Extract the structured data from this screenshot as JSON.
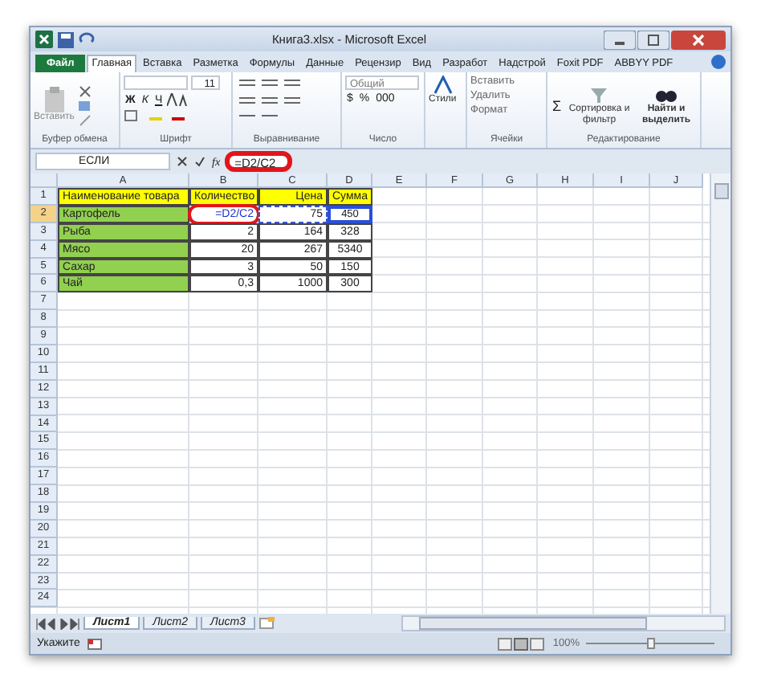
{
  "window": {
    "title": "Книга3.xlsx - Microsoft Excel"
  },
  "ribbon_tabs": [
    {
      "label": "Файл",
      "kind": "file",
      "selected": false
    },
    {
      "label": "Главная",
      "kind": "tab",
      "selected": true
    },
    {
      "label": "Вставка",
      "kind": "tab",
      "selected": false
    },
    {
      "label": "Разметка",
      "kind": "tab",
      "selected": false
    },
    {
      "label": "Формулы",
      "kind": "tab",
      "selected": false
    },
    {
      "label": "Данные",
      "kind": "tab",
      "selected": false
    },
    {
      "label": "Рецензир",
      "kind": "tab",
      "selected": false
    },
    {
      "label": "Вид",
      "kind": "tab",
      "selected": false
    },
    {
      "label": "Разработ",
      "kind": "tab",
      "selected": false
    },
    {
      "label": "Надстрой",
      "kind": "tab",
      "selected": false
    },
    {
      "label": "Foxit PDF",
      "kind": "tab",
      "selected": false
    },
    {
      "label": "ABBYY PDF",
      "kind": "tab",
      "selected": false
    }
  ],
  "ribbon": {
    "clipboard": {
      "paste": "Вставить",
      "label": "Буфер обмена"
    },
    "font": {
      "size": "11",
      "bold": "Ж",
      "italic": "К",
      "underline": "Ч",
      "label": "Шрифт"
    },
    "alignment": {
      "label": "Выравнивание"
    },
    "number": {
      "format": "Общий",
      "currency": "$",
      "percent": "%",
      "thousands": "000",
      "label": "Число"
    },
    "styles": {
      "button": "Стили"
    },
    "cells": {
      "insert": "Вставить",
      "delete": "Удалить",
      "format": "Формат",
      "label": "Ячейки"
    },
    "editing": {
      "sum": "Σ",
      "sort": "Сортировка и фильтр",
      "find": "Найти и выделить",
      "label": "Редактирование"
    }
  },
  "formula_bar": {
    "name_box": "ЕСЛИ",
    "fx": "fx",
    "formula": "=D2/C2",
    "highlighted": true
  },
  "sheet": {
    "columns": [
      "A",
      "B",
      "C",
      "D",
      "E",
      "F",
      "G",
      "H",
      "I",
      "J"
    ],
    "rows": [
      {
        "header": "1",
        "cells": [
          {
            "text": "Наименование товара",
            "color": "#ffff00"
          },
          {
            "text": "Количество",
            "color": "#ffff00"
          },
          {
            "text": "Цена",
            "color": "#ffff00"
          },
          {
            "text": "Сумма",
            "color": "#ffff00"
          }
        ]
      },
      {
        "header": "2",
        "selected": true,
        "cells": [
          {
            "text": "Картофель",
            "color": "#92d050"
          },
          {
            "text": "=D2/C2",
            "editing": true,
            "highlighted": true
          },
          {
            "text": "75",
            "marquee": true
          },
          {
            "text": "450",
            "reference": true
          }
        ]
      },
      {
        "header": "3",
        "cells": [
          {
            "text": "Рыба",
            "color": "#92d050"
          },
          {
            "text": "2"
          },
          {
            "text": "164"
          },
          {
            "text": "328"
          }
        ]
      },
      {
        "header": "4",
        "cells": [
          {
            "text": "Мясо",
            "color": "#92d050"
          },
          {
            "text": "20"
          },
          {
            "text": "267"
          },
          {
            "text": "5340"
          }
        ]
      },
      {
        "header": "5",
        "cells": [
          {
            "text": "Сахар",
            "color": "#92d050"
          },
          {
            "text": "3"
          },
          {
            "text": "50"
          },
          {
            "text": "150"
          }
        ]
      },
      {
        "header": "6",
        "cells": [
          {
            "text": "Чай",
            "color": "#92d050"
          },
          {
            "text": "0,3"
          },
          {
            "text": "1000"
          },
          {
            "text": "300"
          }
        ]
      },
      {
        "header": "7"
      },
      {
        "header": "8"
      },
      {
        "header": "9"
      },
      {
        "header": "10"
      },
      {
        "header": "11"
      },
      {
        "header": "12"
      },
      {
        "header": "13"
      },
      {
        "header": "14"
      },
      {
        "header": "15"
      },
      {
        "header": "16"
      },
      {
        "header": "17"
      },
      {
        "header": "18"
      },
      {
        "header": "19"
      },
      {
        "header": "20"
      },
      {
        "header": "21"
      },
      {
        "header": "22"
      },
      {
        "header": "23"
      },
      {
        "header": "24"
      }
    ]
  },
  "sheet_tabs": [
    {
      "label": "Лист1",
      "selected": true
    },
    {
      "label": "Лист2",
      "selected": false
    },
    {
      "label": "Лист3",
      "selected": false
    }
  ],
  "status_bar": {
    "mode": "Укажите",
    "zoom": "100%",
    "level": 0.5
  }
}
